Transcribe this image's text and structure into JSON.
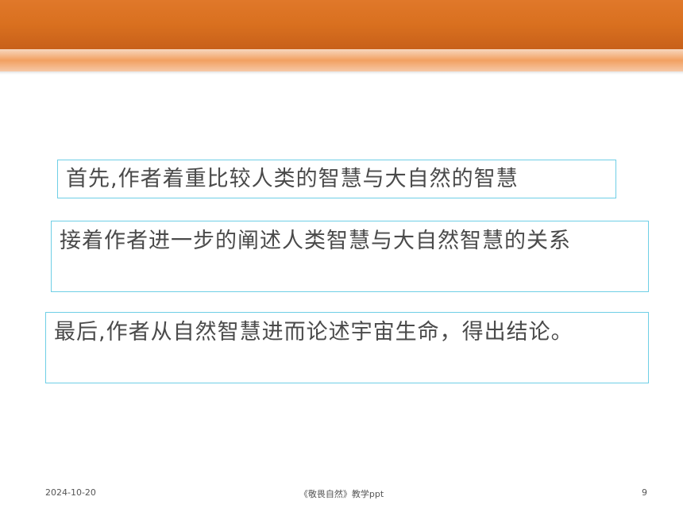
{
  "slide": {
    "bullets": [
      "首先,作者着重比较人类的智慧与大自然的智慧",
      "接着作者进一步的阐述人类智慧与大自然智慧的关系",
      "最后,作者从自然智慧进而论述宇宙生命，得出结论。"
    ]
  },
  "footer": {
    "date": "2024-10-20",
    "title": "《敬畏自然》教学ppt",
    "page": "9"
  },
  "colors": {
    "header_orange": "#d9701f",
    "stripe_light": "#f2a060",
    "box_border": "#6fcfe6",
    "text": "#4a4a4a"
  }
}
